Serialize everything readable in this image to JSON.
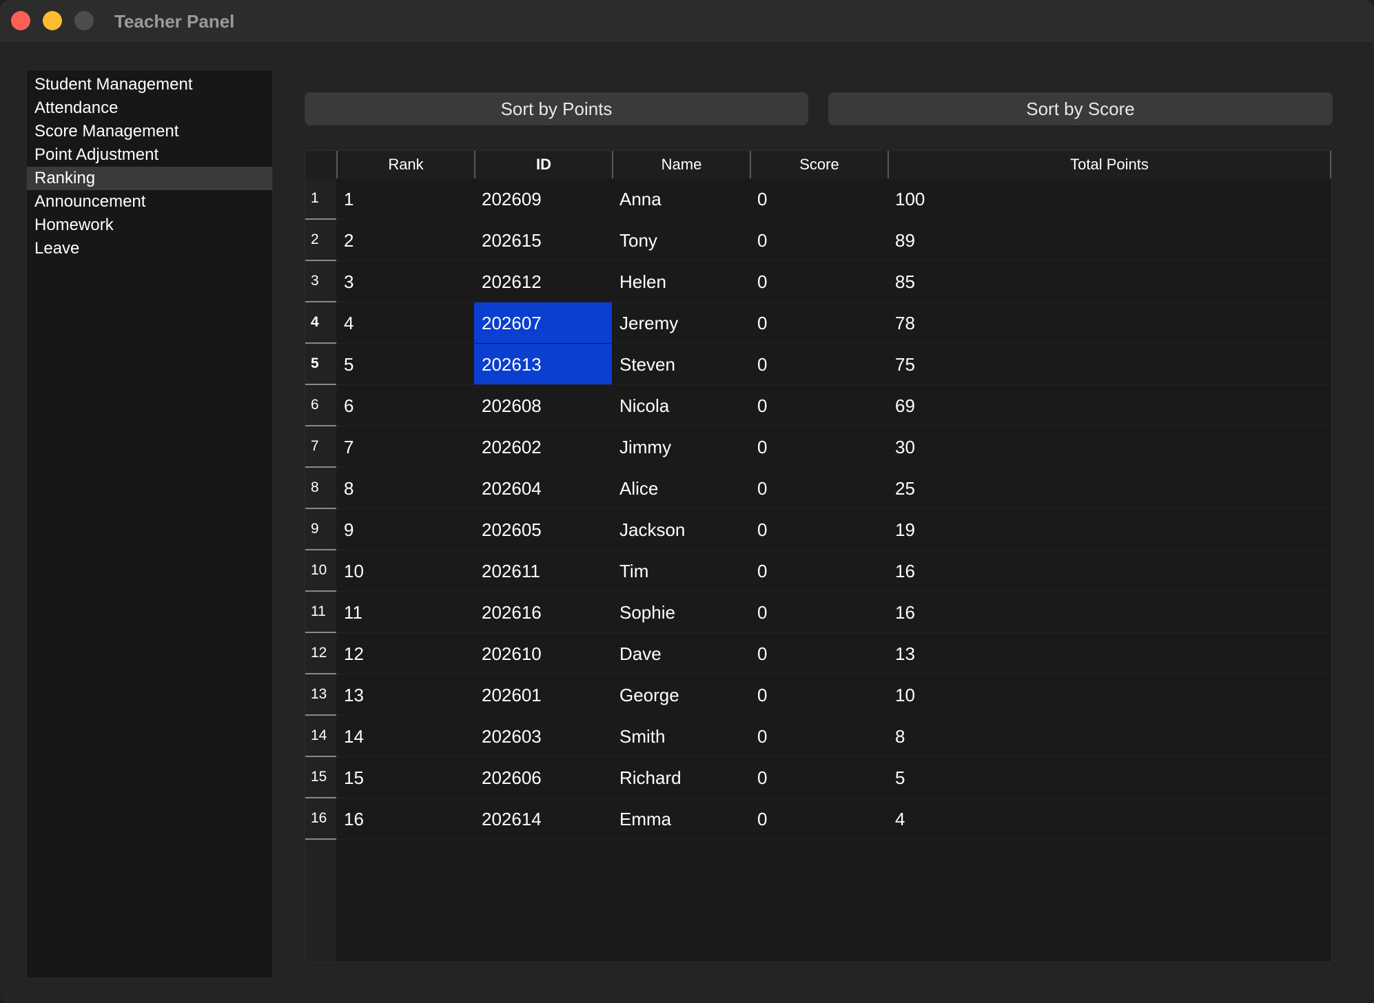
{
  "window": {
    "title": "Teacher Panel"
  },
  "sidebar": {
    "items": [
      {
        "label": "Student Management",
        "selected": false
      },
      {
        "label": "Attendance",
        "selected": false
      },
      {
        "label": "Score Management",
        "selected": false
      },
      {
        "label": "Point Adjustment",
        "selected": false
      },
      {
        "label": "Ranking",
        "selected": true
      },
      {
        "label": "Announcement",
        "selected": false
      },
      {
        "label": "Homework",
        "selected": false
      },
      {
        "label": "Leave",
        "selected": false
      }
    ]
  },
  "toolbar": {
    "sort_points_label": "Sort by Points",
    "sort_score_label": "Sort by Score"
  },
  "table": {
    "columns": [
      "Rank",
      "ID",
      "Name",
      "Score",
      "Total Points"
    ],
    "rows": [
      {
        "num": "1",
        "rank": "1",
        "id": "202609",
        "name": "Anna",
        "score": "0",
        "total": "100"
      },
      {
        "num": "2",
        "rank": "2",
        "id": "202615",
        "name": "Tony",
        "score": "0",
        "total": "89"
      },
      {
        "num": "3",
        "rank": "3",
        "id": "202612",
        "name": "Helen",
        "score": "0",
        "total": "85"
      },
      {
        "num": "4",
        "rank": "4",
        "id": "202607",
        "name": "Jeremy",
        "score": "0",
        "total": "78"
      },
      {
        "num": "5",
        "rank": "5",
        "id": "202613",
        "name": "Steven",
        "score": "0",
        "total": "75"
      },
      {
        "num": "6",
        "rank": "6",
        "id": "202608",
        "name": "Nicola",
        "score": "0",
        "total": "69"
      },
      {
        "num": "7",
        "rank": "7",
        "id": "202602",
        "name": "Jimmy",
        "score": "0",
        "total": "30"
      },
      {
        "num": "8",
        "rank": "8",
        "id": "202604",
        "name": "Alice",
        "score": "0",
        "total": "25"
      },
      {
        "num": "9",
        "rank": "9",
        "id": "202605",
        "name": "Jackson",
        "score": "0",
        "total": "19"
      },
      {
        "num": "10",
        "rank": "10",
        "id": "202611",
        "name": "Tim",
        "score": "0",
        "total": "16"
      },
      {
        "num": "11",
        "rank": "11",
        "id": "202616",
        "name": "Sophie",
        "score": "0",
        "total": "16"
      },
      {
        "num": "12",
        "rank": "12",
        "id": "202610",
        "name": "Dave",
        "score": "0",
        "total": "13"
      },
      {
        "num": "13",
        "rank": "13",
        "id": "202601",
        "name": "George",
        "score": "0",
        "total": "10"
      },
      {
        "num": "14",
        "rank": "14",
        "id": "202603",
        "name": "Smith",
        "score": "0",
        "total": "8"
      },
      {
        "num": "15",
        "rank": "15",
        "id": "202606",
        "name": "Richard",
        "score": "0",
        "total": "5"
      },
      {
        "num": "16",
        "rank": "16",
        "id": "202614",
        "name": "Emma",
        "score": "0",
        "total": "4"
      }
    ],
    "selected_cells": [
      {
        "row": 3,
        "column": "ID"
      },
      {
        "row": 4,
        "column": "ID"
      }
    ]
  },
  "colors": {
    "selection": "#0a3fd0",
    "window_bg": "#242424",
    "close": "#fe5f57",
    "minimize": "#febc2e",
    "zoom": "#4d4d4d"
  }
}
